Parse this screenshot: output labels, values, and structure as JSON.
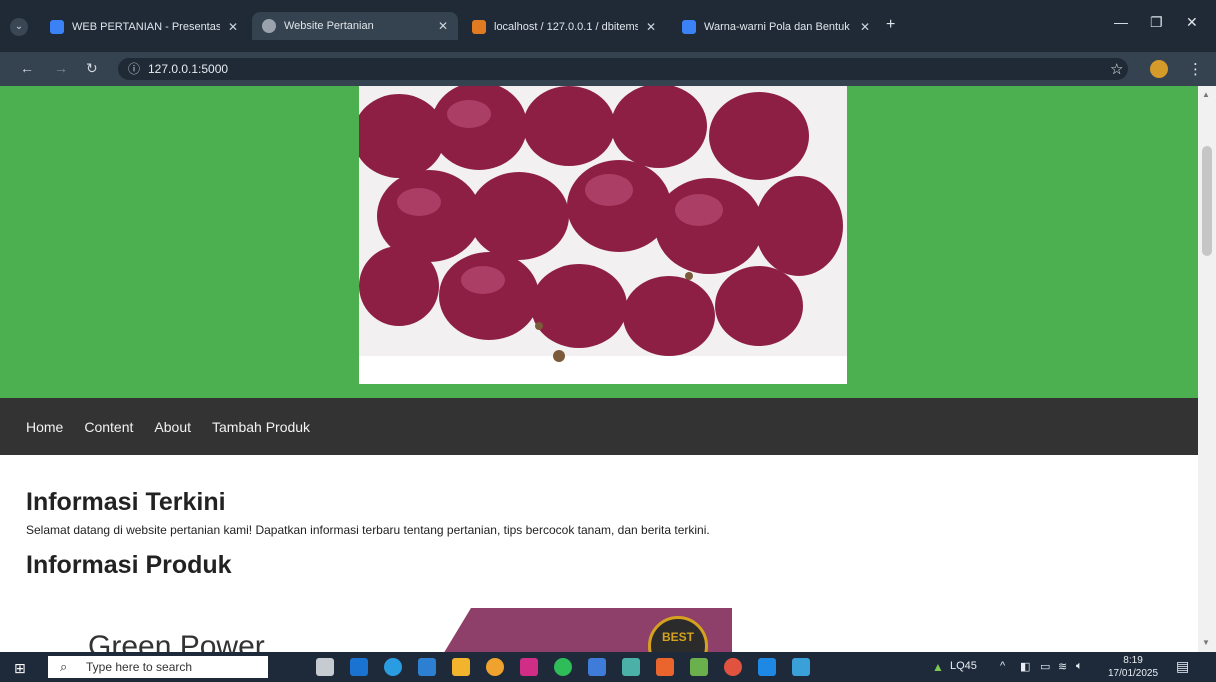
{
  "browser": {
    "tabs": [
      {
        "title": "WEB PERTANIAN - Presentasi -",
        "active": false,
        "favicon_color": "#3b82f6"
      },
      {
        "title": "Website Pertanian",
        "active": true,
        "favicon_color": "#9aa3ad"
      },
      {
        "title": "localhost / 127.0.0.1 / dbitems /",
        "active": false,
        "favicon_color": "#e07b22"
      },
      {
        "title": "Warna-warni Pola dan Bentuk A",
        "active": false,
        "favicon_color": "#3b82f6"
      }
    ],
    "url": "127.0.0.1:5000"
  },
  "page": {
    "nav": [
      "Home",
      "Content",
      "About",
      "Tambah Produk"
    ],
    "section1": {
      "title": "Informasi Terkini",
      "text": "Selamat datang di website pertanian kami! Dapatkan informasi terbaru tentang pertanian, tips bercocok tanam, dan berita terkini."
    },
    "section2": {
      "title": "Informasi Produk"
    },
    "product_preview": {
      "title": "Green Power",
      "badge": "BEST"
    },
    "colors": {
      "hero_bg": "#4caf50",
      "nav_bg": "#333333",
      "accent": "#8e3f6a"
    }
  },
  "taskbar": {
    "search_placeholder": "Type here to search",
    "tray_label": "LQ45",
    "time": "8:19",
    "date": "17/01/2025"
  }
}
